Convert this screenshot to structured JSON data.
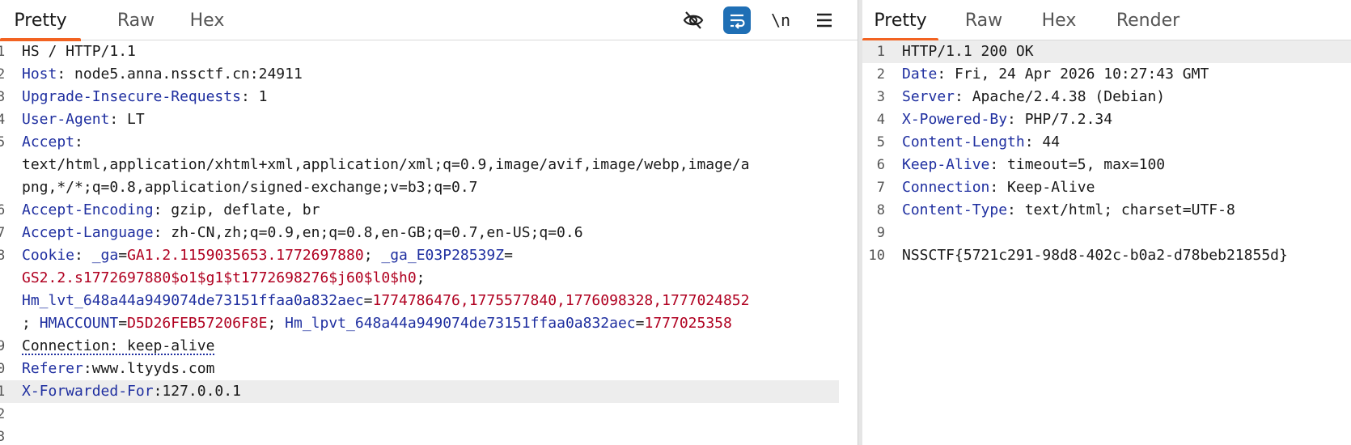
{
  "request": {
    "tabs": [
      "Pretty",
      "Raw",
      "Hex"
    ],
    "active_tab": "Pretty",
    "toolbar": {
      "newline_label": "\\n",
      "icons": [
        "eye-off-icon",
        "wrap-icon",
        "newline-icon",
        "menu-icon"
      ]
    },
    "line_numbers": [
      "1",
      "2",
      "3",
      "4",
      "5",
      "",
      "",
      "6",
      "7",
      "8",
      "",
      "",
      "",
      "9",
      "0",
      "1",
      "2",
      "3"
    ],
    "lines": [
      {
        "text": "HS / HTTP/1.1"
      },
      {
        "key": "Host",
        "rest": ": node5.anna.nssctf.cn:24911"
      },
      {
        "key": "Upgrade-Insecure-Requests",
        "rest": ": 1"
      },
      {
        "key": "User-Agent",
        "rest": ": LT"
      },
      {
        "key": "Accept",
        "rest": ":"
      },
      {
        "text": "text/html,application/xhtml+xml,application/xml;q=0.9,image/avif,image/webp,image/a"
      },
      {
        "text": "png,*/*;q=0.8,application/signed-exchange;v=b3;q=0.7"
      },
      {
        "key": "Accept-Encoding",
        "rest": ": gzip, deflate, br"
      },
      {
        "key": "Accept-Language",
        "rest": ": zh-CN,zh;q=0.9,en;q=0.8,en-GB;q=0.7,en-US;q=0.6"
      },
      {
        "cookie1": {
          "key": "Cookie",
          "sep": ": ",
          "n1": "_ga",
          "eq": "=",
          "v1": "GA1.2.1159035653.1772697880",
          "semi": "; ",
          "n2": "_ga_E03P28539Z",
          "eq2": "="
        }
      },
      {
        "val": "GS2.2.s1772697880$o1$g1$t1772698276$j60$l0$h0",
        "after": ";"
      },
      {
        "cookie3": {
          "n": "Hm_lvt_648a44a949074de73151ffaa0a832aec",
          "eq": "=",
          "v": "1774786476,1775577840,1776098328,1777024852"
        }
      },
      {
        "cookie4": {
          "pre": "; ",
          "n1": "HMACCOUNT",
          "eq": "=",
          "v1": "D5D26FEB57206F8E",
          "semi": "; ",
          "n2": "Hm_lpvt_648a44a949074de73151ffaa0a832aec",
          "eq2": "=",
          "v2": "1777025358"
        }
      },
      {
        "dotted": "Connection: keep-alive"
      },
      {
        "key": "Referer",
        "rest": ":www.ltyyds.com"
      },
      {
        "key": "X-Forwarded-For",
        "rest": ":127.0.0.1"
      },
      {
        "text": ""
      },
      {
        "text": ""
      }
    ]
  },
  "response": {
    "tabs": [
      "Pretty",
      "Raw",
      "Hex",
      "Render"
    ],
    "active_tab": "Pretty",
    "line_numbers": [
      "1",
      "2",
      "3",
      "4",
      "5",
      "6",
      "7",
      "8",
      "9",
      "10"
    ],
    "lines": [
      {
        "text": "HTTP/1.1 200 OK"
      },
      {
        "key": "Date",
        "rest": ": Fri, 24 Apr 2026 10:27:43 GMT"
      },
      {
        "key": "Server",
        "rest": ": Apache/2.4.38 (Debian)"
      },
      {
        "key": "X-Powered-By",
        "rest": ": PHP/7.2.34"
      },
      {
        "key": "Content-Length",
        "rest": ": 44"
      },
      {
        "key": "Keep-Alive",
        "rest": ": timeout=5, max=100"
      },
      {
        "key": "Connection",
        "rest": ": Keep-Alive"
      },
      {
        "key": "Content-Type",
        "rest": ": text/html; charset=UTF-8"
      },
      {
        "text": ""
      },
      {
        "text": "NSSCTF{5721c291-98d8-402c-b0a2-d78beb21855d}"
      }
    ]
  },
  "colors": {
    "accent": "#f26322",
    "key_blue": "#1f2fa0",
    "value_red": "#b00020",
    "active_button": "#1f6fb5"
  }
}
